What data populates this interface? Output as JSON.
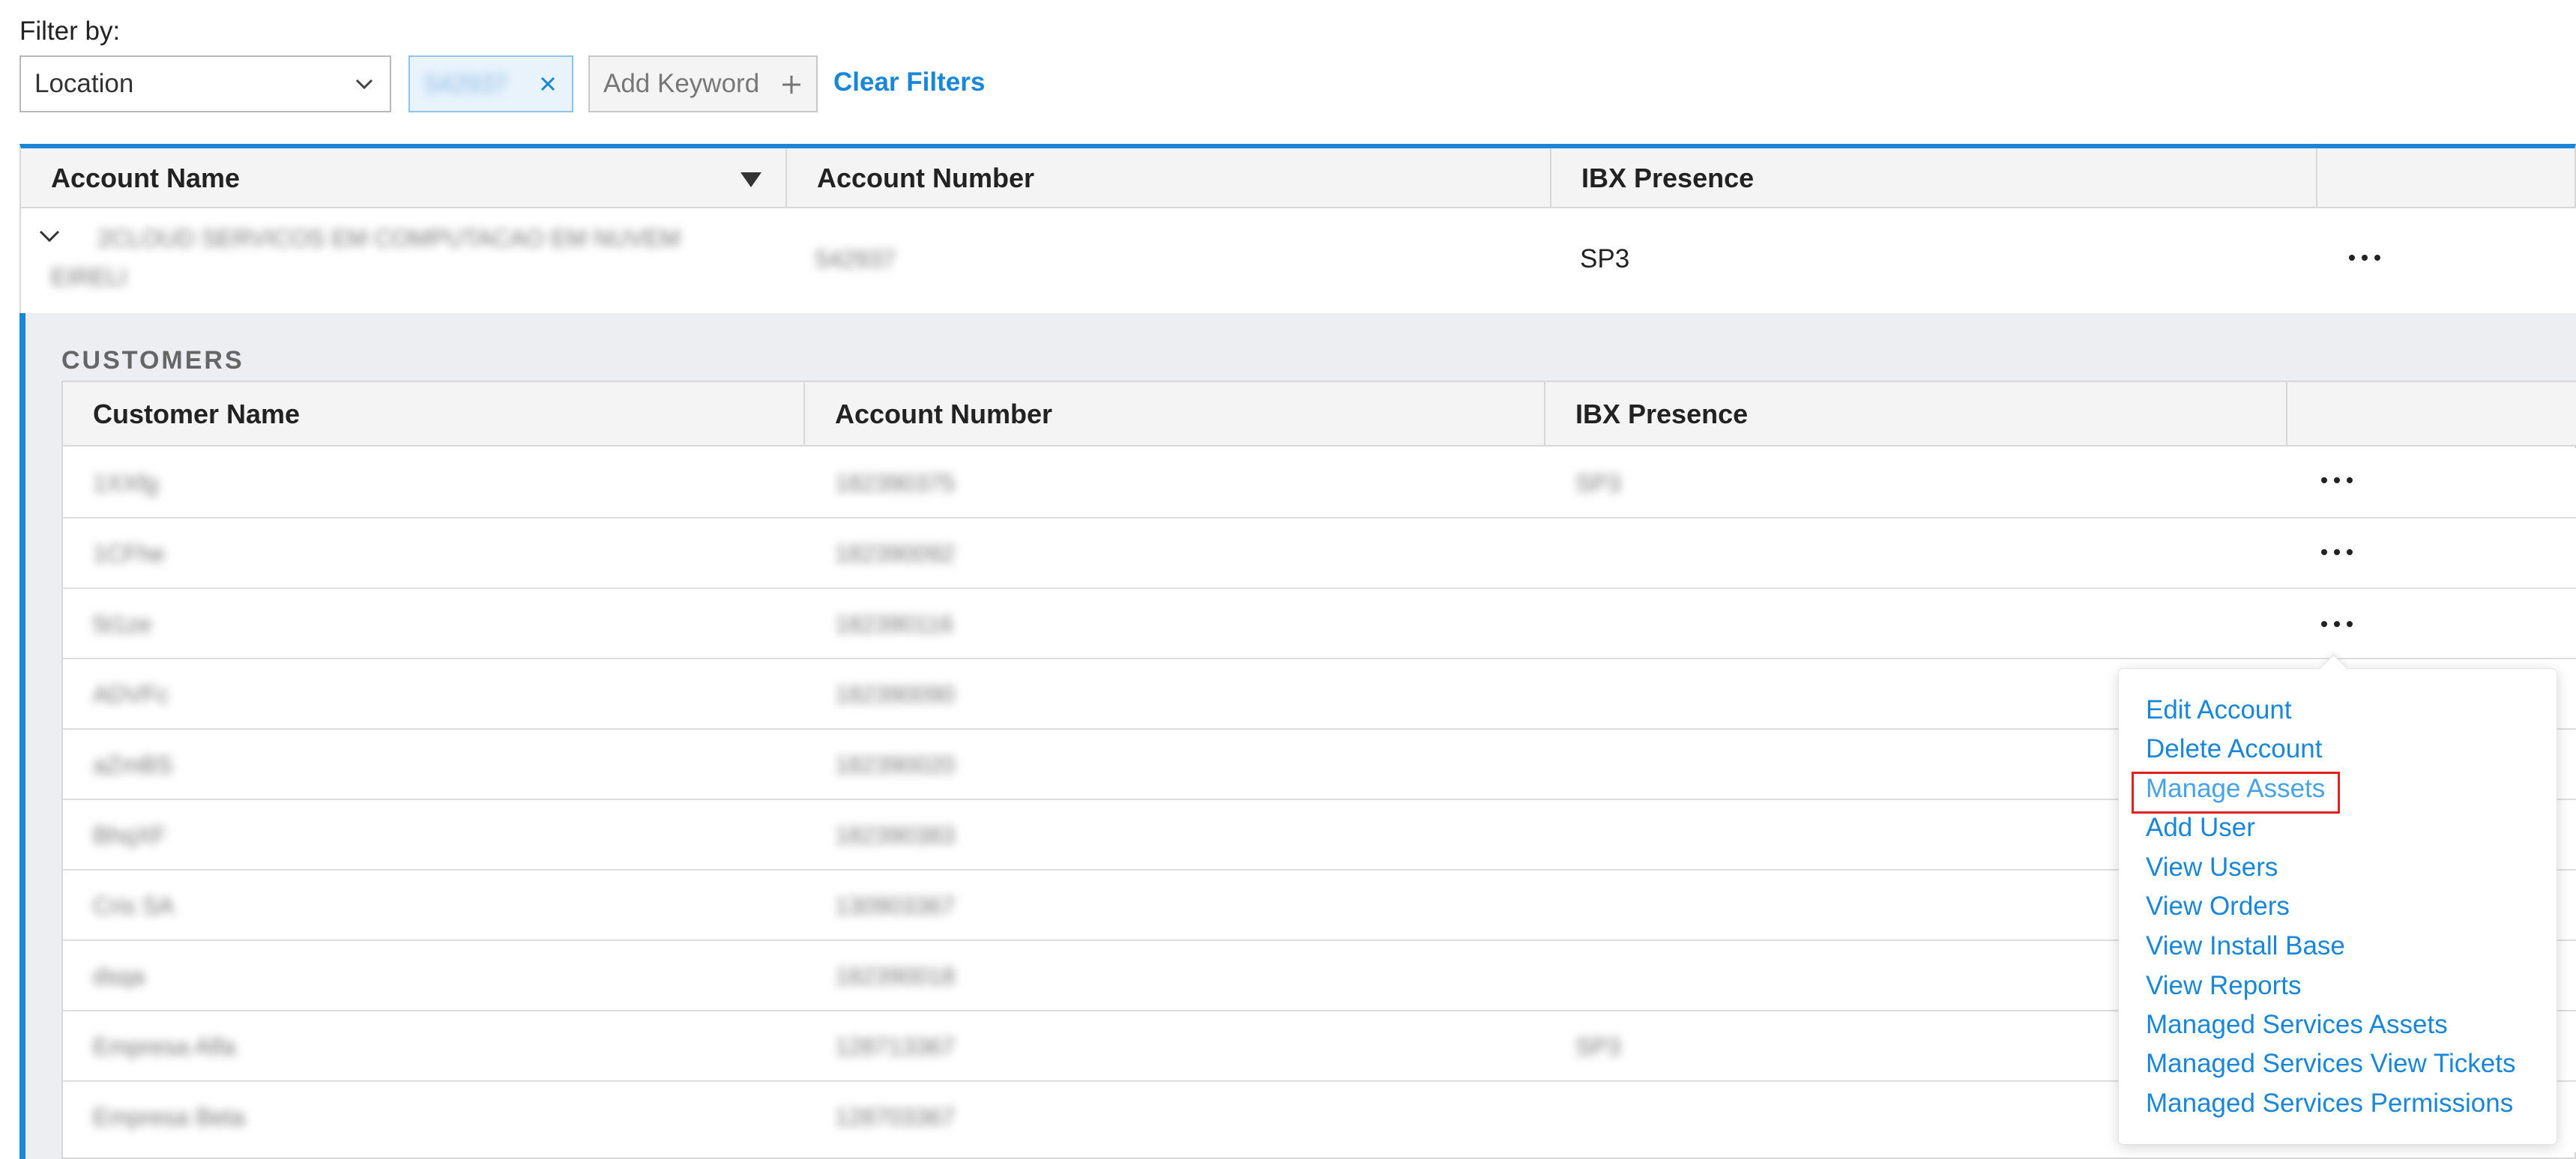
{
  "filter": {
    "label": "Filter by:",
    "location_select": "Location",
    "chip_value": "542937",
    "add_keyword": "Add Keyword",
    "clear_filters": "Clear Filters"
  },
  "outer_table": {
    "headers": [
      "Account Name",
      "Account Number",
      "IBX Presence"
    ],
    "row": {
      "name_line1": "2CLOUD SERVICOS EM COMPUTACAO EM NUVEM",
      "name_line2": "EIRELI",
      "number": "542937",
      "ibx": "SP3"
    }
  },
  "customers": {
    "label": "CUSTOMERS",
    "headers": [
      "Customer Name",
      "Account Number",
      "IBX Presence"
    ],
    "rows": [
      {
        "name": "1XXfg",
        "number": "182390375",
        "ibx": "SP3"
      },
      {
        "name": "1CFhe",
        "number": "182390092",
        "ibx": ""
      },
      {
        "name": "5t1ze",
        "number": "182390116",
        "ibx": ""
      },
      {
        "name": "ADVFc",
        "number": "182390090",
        "ibx": ""
      },
      {
        "name": "aZmBS",
        "number": "182390020",
        "ibx": ""
      },
      {
        "name": "BhqXF",
        "number": "182390383",
        "ibx": ""
      },
      {
        "name": "Cris SA",
        "number": "130903367",
        "ibx": ""
      },
      {
        "name": "dsqa",
        "number": "182390018",
        "ibx": ""
      },
      {
        "name": "Empresa Alfa",
        "number": "128713367",
        "ibx": "SP3"
      },
      {
        "name": "Empresa Beta",
        "number": "128703367",
        "ibx": ""
      }
    ]
  },
  "menu": {
    "items": [
      "Edit Account",
      "Delete Account",
      "Manage Assets",
      "Add User",
      "View Users",
      "View Orders",
      "View Install Base",
      "View Reports",
      "Managed Services Assets",
      "Managed Services View Tickets",
      "Managed Services Permissions"
    ],
    "highlighted": "Manage Assets"
  },
  "colors": {
    "accent": "#1a86d8",
    "highlight_border": "#e0231e",
    "panel_bg": "#eceef2"
  }
}
